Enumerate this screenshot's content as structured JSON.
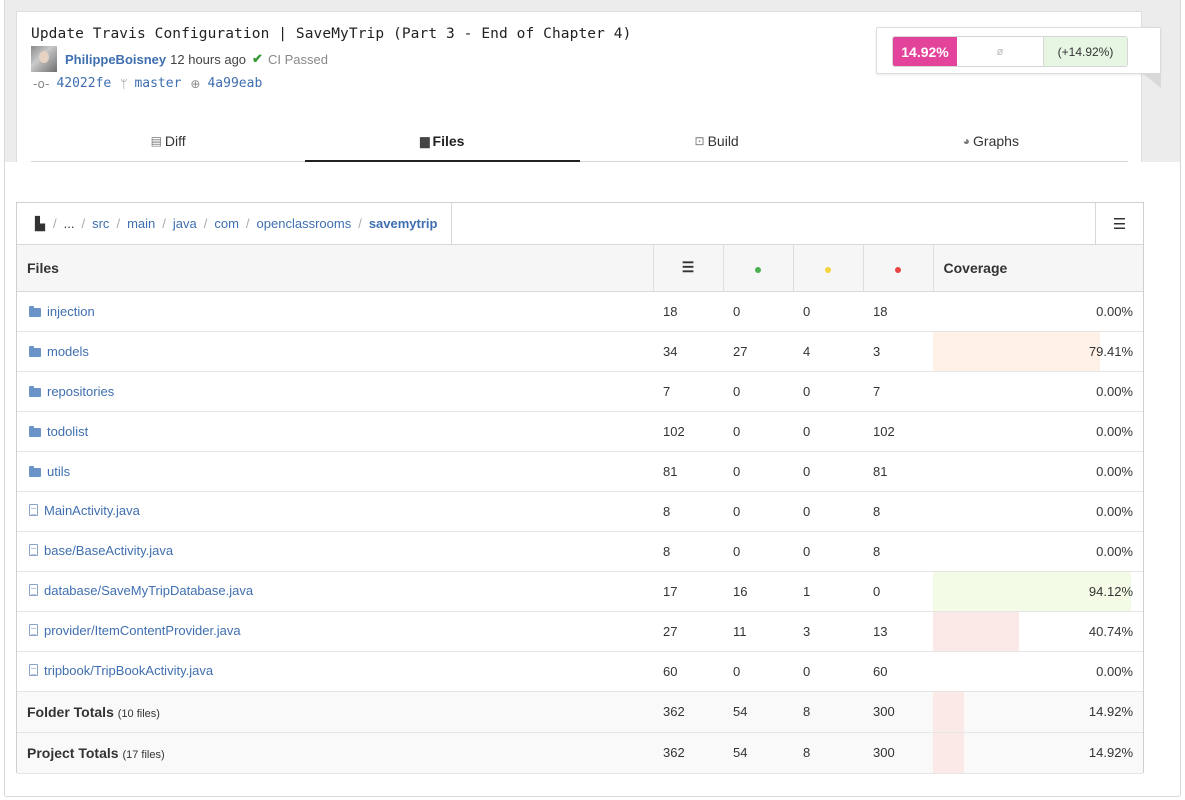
{
  "commit": {
    "title": "Update Travis Configuration | SaveMyTrip (Part 3 - End of Chapter 4)",
    "author": "PhilippeBoisney",
    "time": "12 hours ago",
    "ci_status": "CI Passed",
    "commit_icon": "commit-icon",
    "sha": "42022fe",
    "branch_icon": "branch-icon",
    "branch": "master",
    "parent_icon": "parent-commit-icon",
    "parent_sha": "4a99eab"
  },
  "coverage_summary": {
    "total": "14.92%",
    "base": "ø",
    "delta": "(+14.92%)",
    "colors": {
      "total": "#e3439b",
      "delta_bg": "#e6f6e3"
    }
  },
  "tabs": [
    {
      "label": "Diff",
      "icon": "diff-icon"
    },
    {
      "label": "Files",
      "icon": "folder-icon",
      "active": true
    },
    {
      "label": "Build",
      "icon": "build-icon"
    },
    {
      "label": "Graphs",
      "icon": "pie-chart-icon"
    }
  ],
  "breadcrumb": [
    "...",
    "src",
    "main",
    "java",
    "com",
    "openclassrooms",
    "savemytrip"
  ],
  "table": {
    "columns": {
      "files": "Files",
      "lines_icon": "lines-icon",
      "hit_color": "#4caf50",
      "partial_color": "#f5d33b",
      "miss_color": "#e84545",
      "coverage": "Coverage"
    },
    "rows": [
      {
        "name": "injection",
        "type": "folder",
        "lines": "18",
        "hits": "0",
        "partials": "0",
        "misses": "18",
        "coverage": "0.00%",
        "pct": 0,
        "fill": ""
      },
      {
        "name": "models",
        "type": "folder",
        "lines": "34",
        "hits": "27",
        "partials": "4",
        "misses": "3",
        "coverage": "79.41%",
        "pct": 79.41,
        "fill": "#fff1e6"
      },
      {
        "name": "repositories",
        "type": "folder",
        "lines": "7",
        "hits": "0",
        "partials": "0",
        "misses": "7",
        "coverage": "0.00%",
        "pct": 0,
        "fill": ""
      },
      {
        "name": "todolist",
        "type": "folder",
        "lines": "102",
        "hits": "0",
        "partials": "0",
        "misses": "102",
        "coverage": "0.00%",
        "pct": 0,
        "fill": ""
      },
      {
        "name": "utils",
        "type": "folder",
        "lines": "81",
        "hits": "0",
        "partials": "0",
        "misses": "81",
        "coverage": "0.00%",
        "pct": 0,
        "fill": ""
      },
      {
        "name": "MainActivity.java",
        "type": "file",
        "lines": "8",
        "hits": "0",
        "partials": "0",
        "misses": "8",
        "coverage": "0.00%",
        "pct": 0,
        "fill": ""
      },
      {
        "name": "base/BaseActivity.java",
        "type": "file",
        "lines": "8",
        "hits": "0",
        "partials": "0",
        "misses": "8",
        "coverage": "0.00%",
        "pct": 0,
        "fill": ""
      },
      {
        "name": "database/SaveMyTripDatabase.java",
        "type": "file",
        "lines": "17",
        "hits": "16",
        "partials": "1",
        "misses": "0",
        "coverage": "94.12%",
        "pct": 94.12,
        "fill": "#f3fbe6"
      },
      {
        "name": "provider/ItemContentProvider.java",
        "type": "file",
        "lines": "27",
        "hits": "11",
        "partials": "3",
        "misses": "13",
        "coverage": "40.74%",
        "pct": 40.74,
        "fill": "#fbe9e7"
      },
      {
        "name": "tripbook/TripBookActivity.java",
        "type": "file",
        "lines": "60",
        "hits": "0",
        "partials": "0",
        "misses": "60",
        "coverage": "0.00%",
        "pct": 0,
        "fill": ""
      }
    ],
    "totals": [
      {
        "label": "Folder Totals",
        "sub": "(10 files)",
        "lines": "362",
        "hits": "54",
        "partials": "8",
        "misses": "300",
        "coverage": "14.92%",
        "pct": 14.92,
        "fill": "#fbe9e7"
      },
      {
        "label": "Project Totals",
        "sub": "(17 files)",
        "lines": "362",
        "hits": "54",
        "partials": "8",
        "misses": "300",
        "coverage": "14.92%",
        "pct": 14.92,
        "fill": "#fbe9e7"
      }
    ]
  }
}
